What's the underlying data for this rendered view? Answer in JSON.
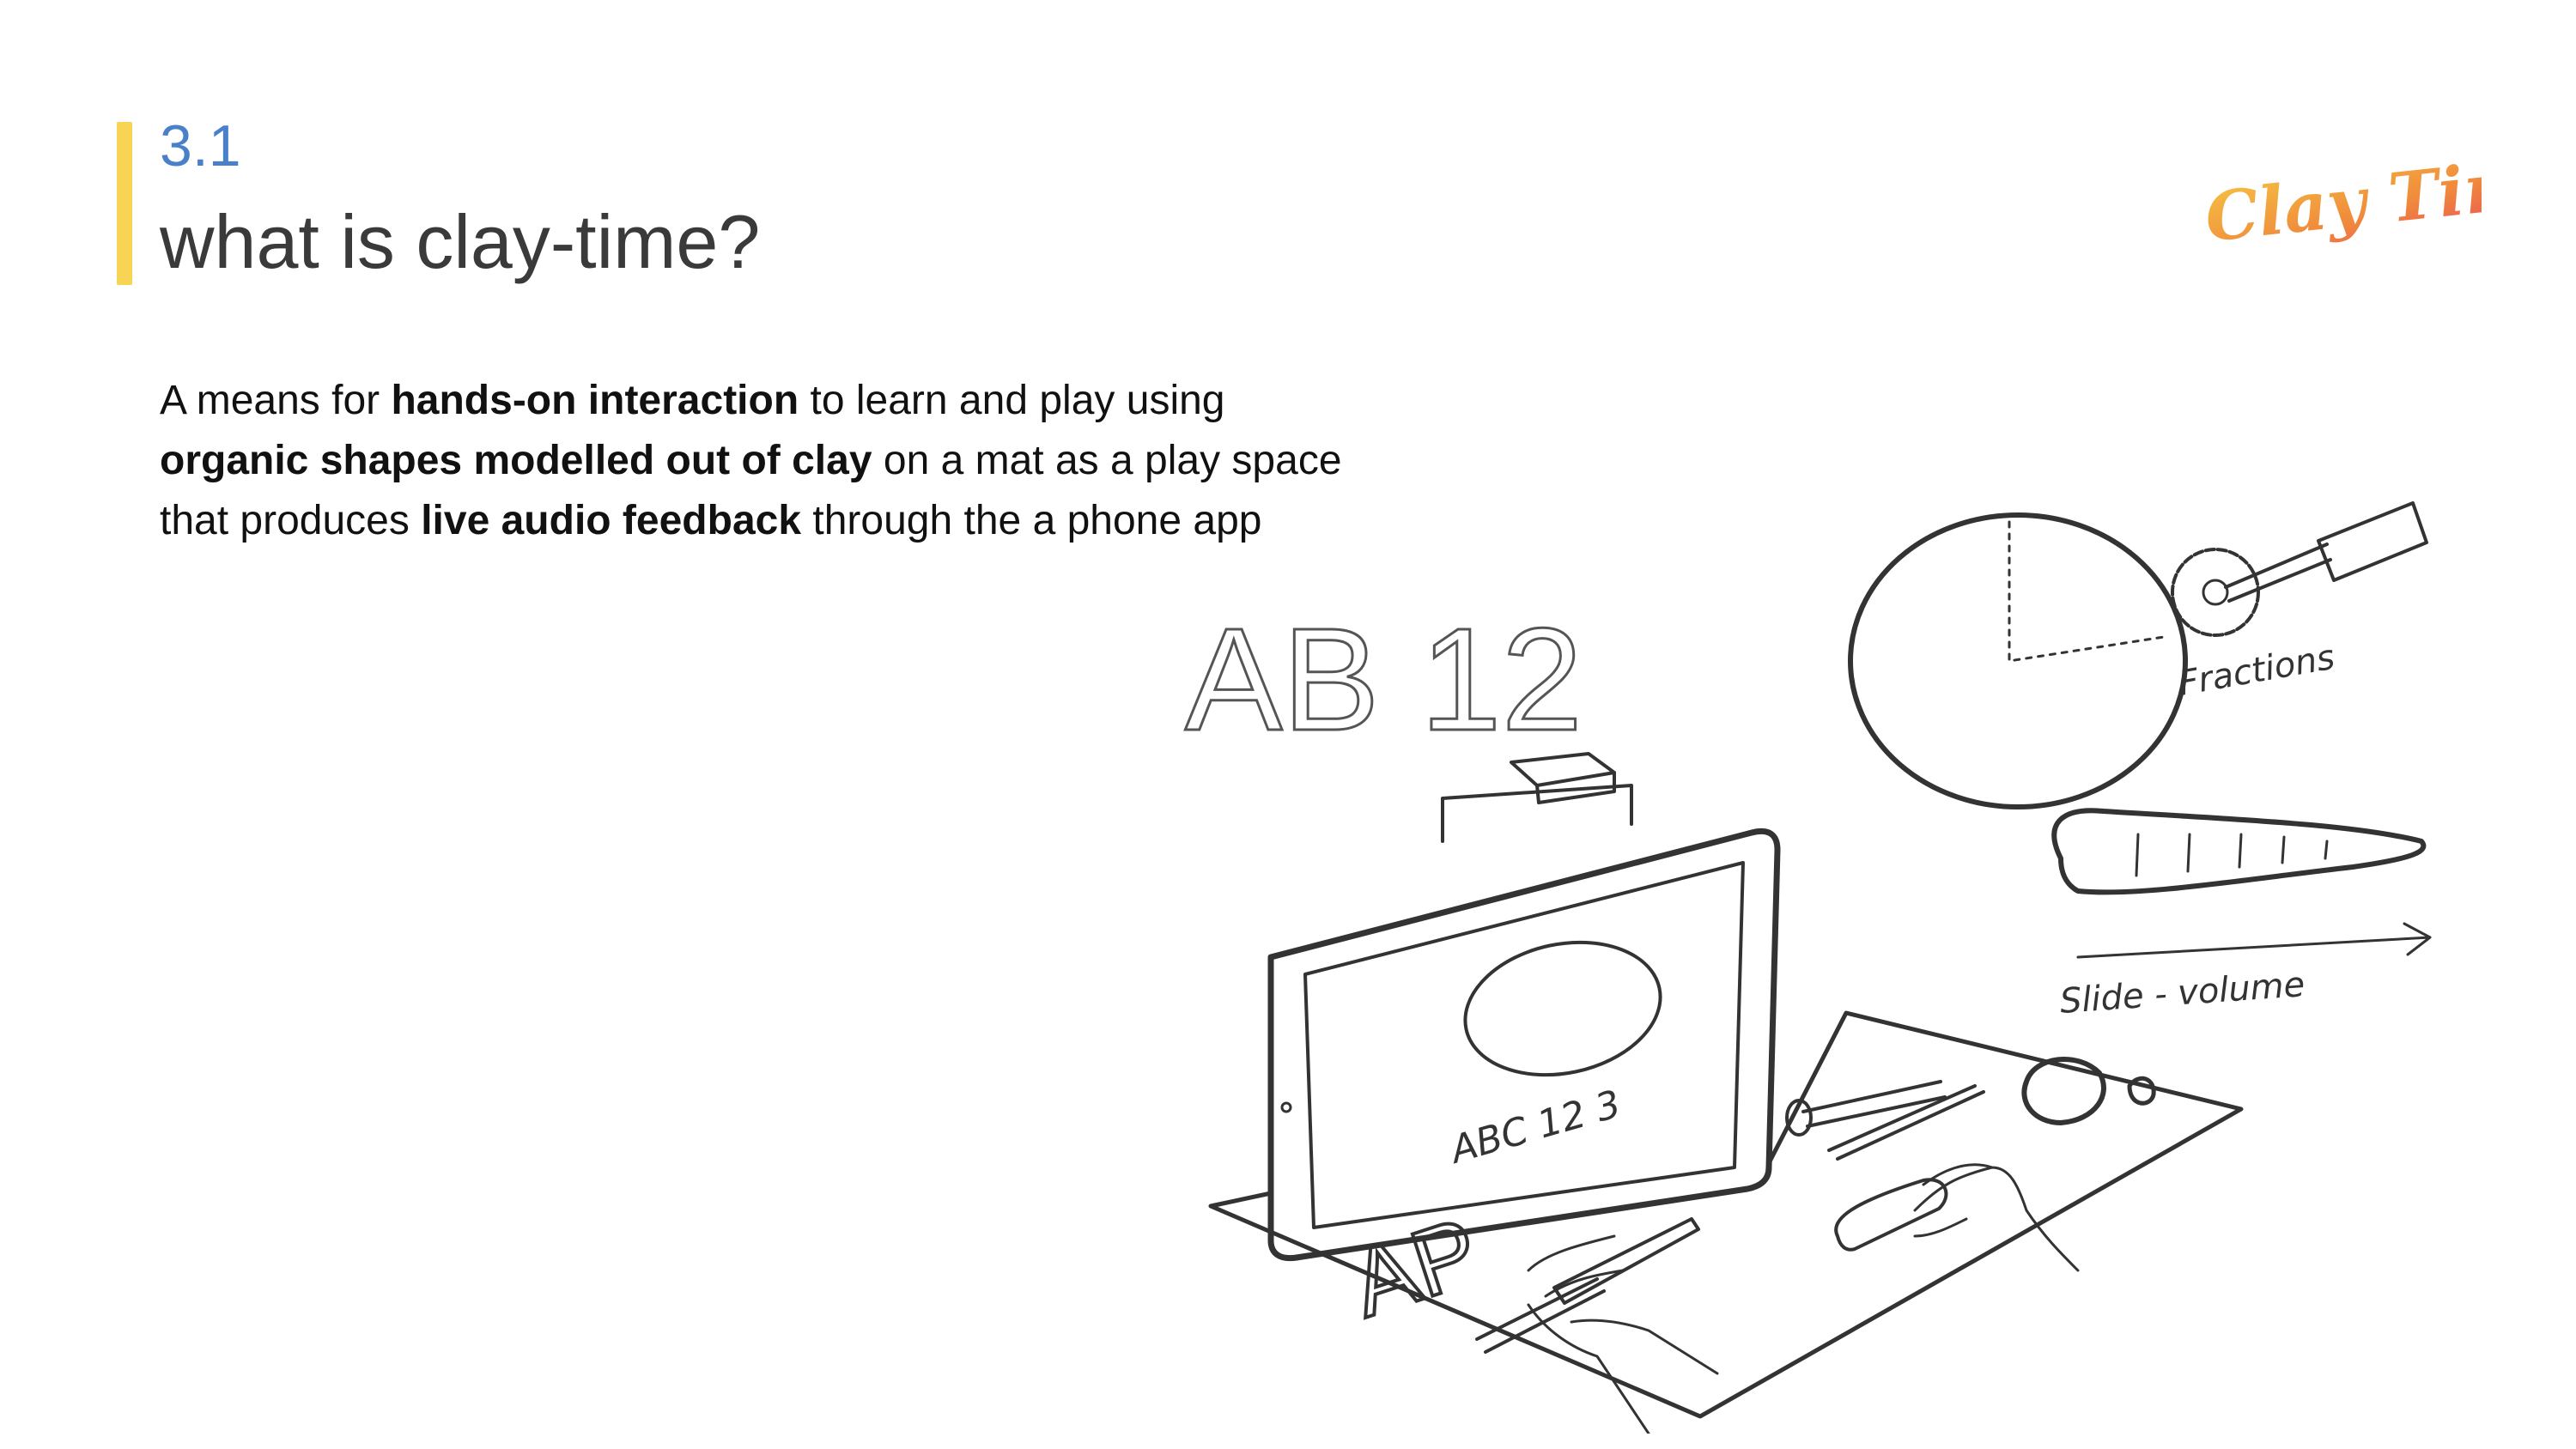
{
  "slide": {
    "section_number": "3.1",
    "title": "what is clay-time?",
    "accent_color": "#f7d453",
    "section_color": "#4a7fc9"
  },
  "body": {
    "t1": "A means for ",
    "b1": "hands-on interaction",
    "t2": " to learn and play using ",
    "b2": "organic shapes modelled out of clay",
    "t3": " on a mat as a play space that produces ",
    "b3": "live audio feedback",
    "t4": " through the a phone app"
  },
  "logo": {
    "text": "Clay Time",
    "gradient": [
      "#f5c542",
      "#f08a3c",
      "#e8455a"
    ]
  },
  "sketch": {
    "letters_large": "AB 12",
    "label_fractions": "Fractions",
    "label_slide_volume": "Slide - volume",
    "screen_text": "ABC  12 3",
    "mat_letters": "AP"
  }
}
